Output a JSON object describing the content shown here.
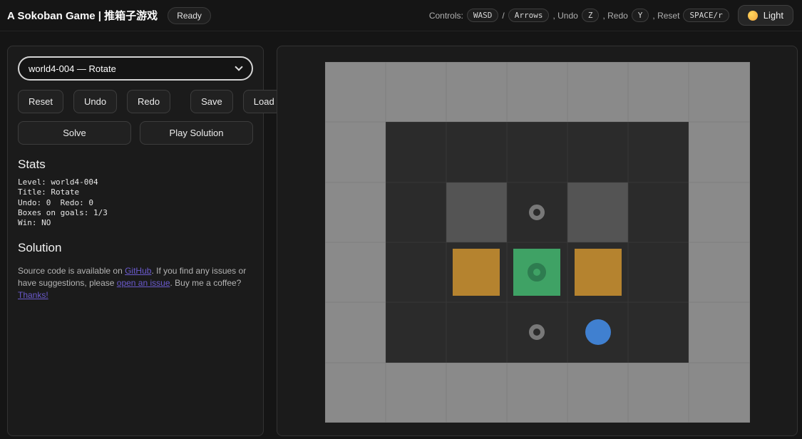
{
  "header": {
    "title": "A Sokoban Game | 推箱子游戏",
    "status_badge": "Ready",
    "controls": {
      "label": "Controls:",
      "move_key": "WASD",
      "separator": "/",
      "arrows_key": "Arrows",
      "undo_label": ", Undo",
      "undo_key": "Z",
      "redo_label": ", Redo",
      "redo_key": "Y",
      "reset_label": ", Reset",
      "reset_key": "SPACE/r"
    },
    "theme_toggle": {
      "label": "Light",
      "icon": "sun-icon"
    }
  },
  "sidebar": {
    "level_select": {
      "value": "world4-004 — Rotate"
    },
    "toolbar": {
      "reset": "Reset",
      "undo": "Undo",
      "redo": "Redo",
      "save": "Save",
      "load": "Load",
      "solve": "Solve",
      "play_solution": "Play Solution"
    },
    "stats": {
      "heading": "Stats",
      "lines": {
        "level": "Level: world4-004",
        "title": "Title: Rotate",
        "undo_redo": "Undo: 0  Redo: 0",
        "boxes_on_goals": "Boxes on goals: 1/3",
        "win": "Win: NO"
      }
    },
    "solution": {
      "heading": "Solution"
    },
    "footer": {
      "p1": "Source code is available on ",
      "link_github": "GitHub",
      "p2": ". If you find any issues or have suggestions, please ",
      "link_issue": "open an issue",
      "p3": ". Buy me a coffee? ",
      "link_thanks": "Thanks!"
    }
  },
  "board": {
    "legend": {
      "O": "outside",
      ".": "floor",
      "W": "wall",
      "G": "goal",
      "B": "box",
      "X": "box-on-goal",
      "P": "player"
    },
    "grid": [
      "OOOOOOO",
      "O.....O",
      "O.WGW.O",
      "O.BXB.O",
      "O..GP.O",
      "OOOOOOO"
    ],
    "colors": {
      "outside": "#8a8a8a",
      "wall": "#545454",
      "floor": "#2b2b2b",
      "box": "#b5832f",
      "box_on_goal": "#3fa265",
      "goal_ring": "#787878",
      "ring_on_box": "#2e7c50",
      "player": "#4080d0",
      "link": "#6a5acd",
      "sun": "#f2a33c"
    }
  }
}
